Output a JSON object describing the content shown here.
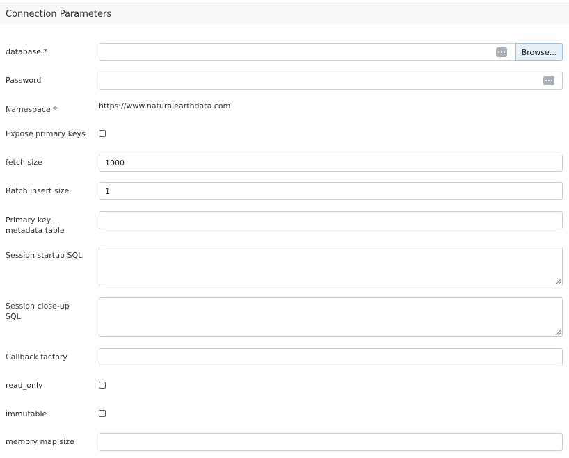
{
  "panel": {
    "title": "Connection Parameters"
  },
  "fields": {
    "database": {
      "label": "database *",
      "value": "",
      "browse_label": "Browse...",
      "icon": "ellipsis-icon"
    },
    "password": {
      "label": "Password",
      "value": "",
      "icon": "ellipsis-icon"
    },
    "namespace": {
      "label": "Namespace *",
      "value": "https://www.naturalearthdata.com"
    },
    "expose_pk": {
      "label": "Expose primary keys",
      "checked": false
    },
    "fetch_size": {
      "label": "fetch size",
      "value": "1000"
    },
    "batch_insert": {
      "label": "Batch insert size",
      "value": "1"
    },
    "pk_table": {
      "label_line1": "Primary key",
      "label_line2": "metadata table",
      "value": ""
    },
    "startup_sql": {
      "label": "Session startup SQL",
      "value": ""
    },
    "closeup_sql": {
      "label_line1": "Session close-up",
      "label_line2": "SQL",
      "value": ""
    },
    "callback": {
      "label": "Callback factory",
      "value": ""
    },
    "read_only": {
      "label": "read_only",
      "checked": false
    },
    "immutable": {
      "label": "immutable",
      "checked": false
    },
    "mmap_size": {
      "label": "memory map size",
      "value": ""
    }
  }
}
